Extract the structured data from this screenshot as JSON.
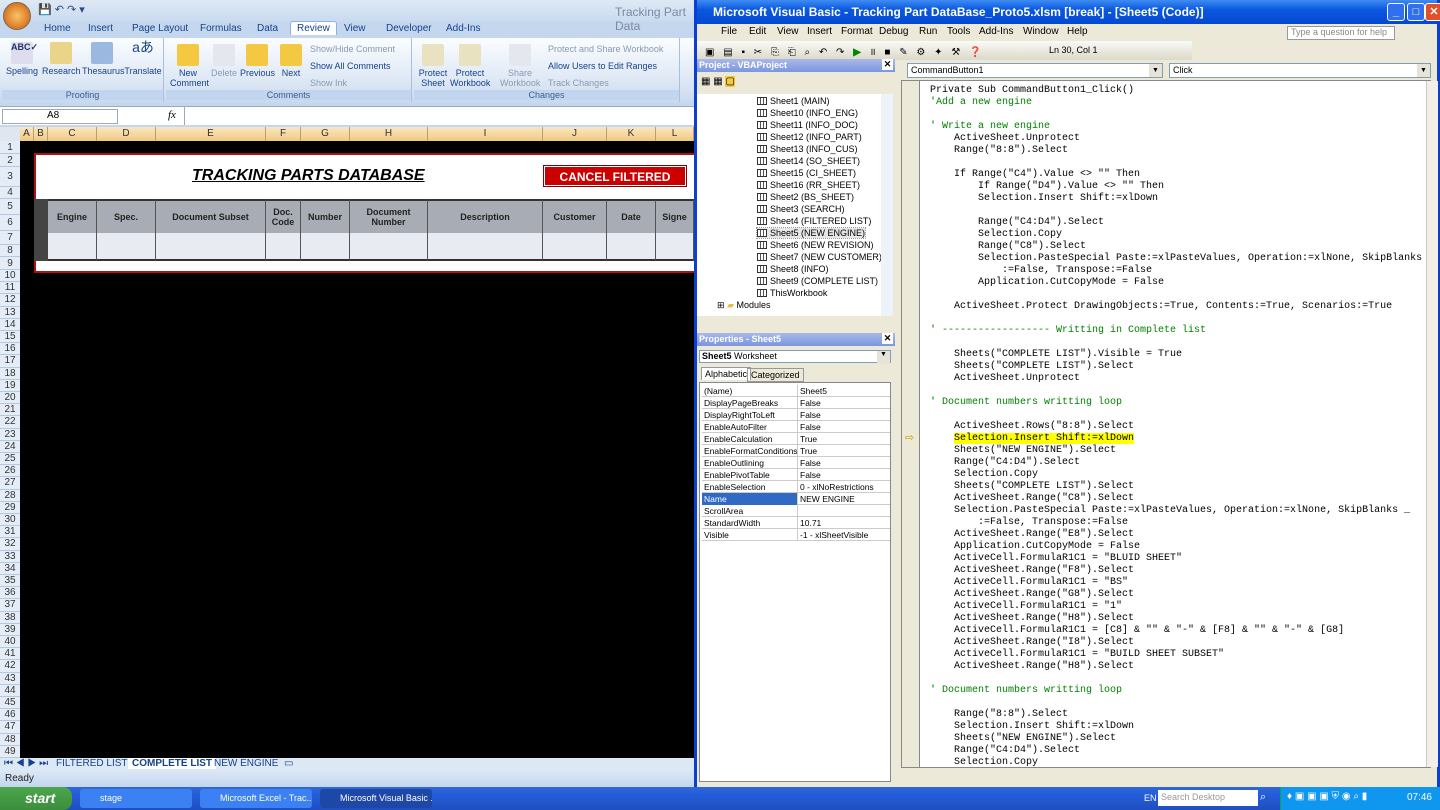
{
  "excel": {
    "title": "Tracking Part Data",
    "tabs": [
      "Home",
      "Insert",
      "Page Layout",
      "Formulas",
      "Data",
      "Review",
      "View",
      "Developer",
      "Add-Ins"
    ],
    "active_tab": "Review",
    "groups": {
      "proofing": "Proofing",
      "comments": "Comments",
      "changes": "Changes"
    },
    "ribbon": {
      "spelling": "Spelling",
      "research": "Research",
      "thesaurus": "Thesaurus",
      "translate": "Translate",
      "new_comment": "New Comment",
      "delete": "Delete",
      "previous": "Previous",
      "next": "Next",
      "show_hide": "Show/Hide Comment",
      "show_all": "Show All Comments",
      "show_ink": "Show Ink",
      "protect_sheet": "Protect Sheet",
      "protect_workbook": "Protect Workbook",
      "share_workbook": "Share Workbook",
      "protect_share": "Protect and Share Workbook",
      "allow_users": "Allow Users to Edit Ranges",
      "track_changes": "Track Changes"
    },
    "name_box": "A8",
    "fx": "fx",
    "formula": "",
    "columns": [
      "A",
      "B",
      "C",
      "D",
      "E",
      "F",
      "G",
      "H",
      "I",
      "J",
      "K",
      "L"
    ],
    "rows": [
      "1",
      "2",
      "3",
      "4",
      "5",
      "6",
      "7",
      "8",
      "9",
      "10",
      "11",
      "12",
      "13",
      "14",
      "15",
      "16",
      "17",
      "18",
      "19",
      "20",
      "21",
      "22",
      "23",
      "24",
      "25",
      "26",
      "27",
      "28",
      "29",
      "30",
      "31",
      "32",
      "33",
      "34",
      "35",
      "36",
      "37",
      "38",
      "39",
      "40",
      "41",
      "42",
      "43",
      "44",
      "45",
      "46",
      "47",
      "48",
      "49"
    ],
    "sheet_title": "TRACKING PARTS DATABASE",
    "cancel_button": "CANCEL FILTERED LIST",
    "headers": [
      "Engine",
      "Spec.",
      "Document Subset",
      "Doc. Code",
      "Number",
      "Document Number",
      "Description",
      "Customer",
      "Date",
      "Signe"
    ],
    "sheet_tabs": [
      "FILTERED LIST",
      "COMPLETE LIST",
      "NEW ENGINE"
    ],
    "active_sheet": "COMPLETE LIST",
    "status": "Ready"
  },
  "vba": {
    "title": "Microsoft Visual Basic - Tracking Part DataBase_Proto5.xlsm [break] - [Sheet5 (Code)]",
    "menu": [
      "File",
      "Edit",
      "View",
      "Insert",
      "Format",
      "Debug",
      "Run",
      "Tools",
      "Add-Ins",
      "Window",
      "Help"
    ],
    "help_placeholder": "Type a question for help",
    "position": "Ln 30, Col 1",
    "project_title": "Project - VBAProject",
    "tree": [
      "Sheet1 (MAIN)",
      "Sheet10 (INFO_ENG)",
      "Sheet11 (INFO_DOC)",
      "Sheet12 (INFO_PART)",
      "Sheet13 (INFO_CUS)",
      "Sheet14 (SO_SHEET)",
      "Sheet15 (CI_SHEET)",
      "Sheet16 (RR_SHEET)",
      "Sheet2 (BS_SHEET)",
      "Sheet3 (SEARCH)",
      "Sheet4 (FILTERED LIST)",
      "Sheet5 (NEW ENGINE)",
      "Sheet6 (NEW REVISION)",
      "Sheet7 (NEW CUSTOMER)",
      "Sheet8 (INFO)",
      "Sheet9 (COMPLETE LIST)",
      "ThisWorkbook"
    ],
    "tree_selected": "Sheet5 (NEW ENGINE)",
    "modules": "Modules",
    "properties_title": "Properties - Sheet5",
    "object_name": "Sheet5",
    "object_type": "Worksheet",
    "prop_tabs": [
      "Alphabetic",
      "Categorized"
    ],
    "properties": [
      [
        "(Name)",
        "Sheet5"
      ],
      [
        "DisplayPageBreaks",
        "False"
      ],
      [
        "DisplayRightToLeft",
        "False"
      ],
      [
        "EnableAutoFilter",
        "False"
      ],
      [
        "EnableCalculation",
        "True"
      ],
      [
        "EnableFormatConditionsCalculation",
        "True"
      ],
      [
        "EnableOutlining",
        "False"
      ],
      [
        "EnablePivotTable",
        "False"
      ],
      [
        "EnableSelection",
        "0 - xlNoRestrictions"
      ],
      [
        "Name",
        "NEW ENGINE"
      ],
      [
        "ScrollArea",
        ""
      ],
      [
        "StandardWidth",
        "10.71"
      ],
      [
        "Visible",
        "-1 - xlSheetVisible"
      ]
    ],
    "selected_property": "Name",
    "object_dropdown": "CommandButton1",
    "proc_dropdown": "Click",
    "highlight_color": "#ffff00",
    "code": [
      [
        "Private Sub CommandButton1_Click()",
        "code"
      ],
      [
        "'Add a new engine",
        "comment"
      ],
      [
        "",
        ""
      ],
      [
        "' Write a new engine",
        "comment"
      ],
      [
        "    ActiveSheet.Unprotect",
        "code"
      ],
      [
        "    Range(\"8:8\").Select",
        "code"
      ],
      [
        "",
        ""
      ],
      [
        "    If Range(\"C4\").Value <> \"\" Then",
        "code"
      ],
      [
        "        If Range(\"D4\").Value <> \"\" Then",
        "code"
      ],
      [
        "        Selection.Insert Shift:=xlDown",
        "code"
      ],
      [
        "",
        ""
      ],
      [
        "        Range(\"C4:D4\").Select",
        "code"
      ],
      [
        "        Selection.Copy",
        "code"
      ],
      [
        "        Range(\"C8\").Select",
        "code"
      ],
      [
        "        Selection.PasteSpecial Paste:=xlPasteValues, Operation:=xlNone, SkipBlanks",
        "code"
      ],
      [
        "            :=False, Transpose:=False",
        "code"
      ],
      [
        "        Application.CutCopyMode = False",
        "code"
      ],
      [
        "",
        ""
      ],
      [
        "    ActiveSheet.Protect DrawingObjects:=True, Contents:=True, Scenarios:=True",
        "code"
      ],
      [
        "",
        ""
      ],
      [
        "' ------------------ Writting in Complete list",
        "comment"
      ],
      [
        "",
        ""
      ],
      [
        "    Sheets(\"COMPLETE LIST\").Visible = True",
        "code"
      ],
      [
        "    Sheets(\"COMPLETE LIST\").Select",
        "code"
      ],
      [
        "    ActiveSheet.Unprotect",
        "code"
      ],
      [
        "",
        ""
      ],
      [
        "' Document numbers writting loop",
        "comment"
      ],
      [
        "",
        ""
      ],
      [
        "    ActiveSheet.Rows(\"8:8\").Select",
        "code"
      ],
      [
        "    Selection.Insert Shift:=xlDown",
        "highlight"
      ],
      [
        "    Sheets(\"NEW ENGINE\").Select",
        "code"
      ],
      [
        "    Range(\"C4:D4\").Select",
        "code"
      ],
      [
        "    Selection.Copy",
        "code"
      ],
      [
        "    Sheets(\"COMPLETE LIST\").Select",
        "code"
      ],
      [
        "    ActiveSheet.Range(\"C8\").Select",
        "code"
      ],
      [
        "    Selection.PasteSpecial Paste:=xlPasteValues, Operation:=xlNone, SkipBlanks _",
        "code"
      ],
      [
        "        :=False, Transpose:=False",
        "code"
      ],
      [
        "    ActiveSheet.Range(\"E8\").Select",
        "code"
      ],
      [
        "    Application.CutCopyMode = False",
        "code"
      ],
      [
        "    ActiveCell.FormulaR1C1 = \"BLUID SHEET\"",
        "code"
      ],
      [
        "    ActiveSheet.Range(\"F8\").Select",
        "code"
      ],
      [
        "    ActiveCell.FormulaR1C1 = \"BS\"",
        "code"
      ],
      [
        "    ActiveSheet.Range(\"G8\").Select",
        "code"
      ],
      [
        "    ActiveCell.FormulaR1C1 = \"1\"",
        "code"
      ],
      [
        "    ActiveSheet.Range(\"H8\").Select",
        "code"
      ],
      [
        "    ActiveCell.FormulaR1C1 = [C8] & \"\" & \"-\" & [F8] & \"\" & \"-\" & [G8]",
        "code"
      ],
      [
        "    ActiveSheet.Range(\"I8\").Select",
        "code"
      ],
      [
        "    ActiveCell.FormulaR1C1 = \"BUILD SHEET SUBSET\"",
        "code"
      ],
      [
        "    ActiveSheet.Range(\"H8\").Select",
        "code"
      ],
      [
        "",
        ""
      ],
      [
        "' Document numbers writting loop",
        "comment"
      ],
      [
        "",
        ""
      ],
      [
        "    Range(\"8:8\").Select",
        "code"
      ],
      [
        "    Selection.Insert Shift:=xlDown",
        "code"
      ],
      [
        "    Sheets(\"NEW ENGINE\").Select",
        "code"
      ],
      [
        "    Range(\"C4:D4\").Select",
        "code"
      ],
      [
        "    Selection.Copy",
        "code"
      ]
    ]
  },
  "taskbar": {
    "start": "start",
    "tasks": [
      "stage",
      "Microsoft Excel - Trac...",
      "Microsoft Visual Basic ..."
    ],
    "active_task": "Microsoft Visual Basic ...",
    "lang": "EN",
    "search_placeholder": "Search Desktop",
    "clock": "07:46"
  }
}
